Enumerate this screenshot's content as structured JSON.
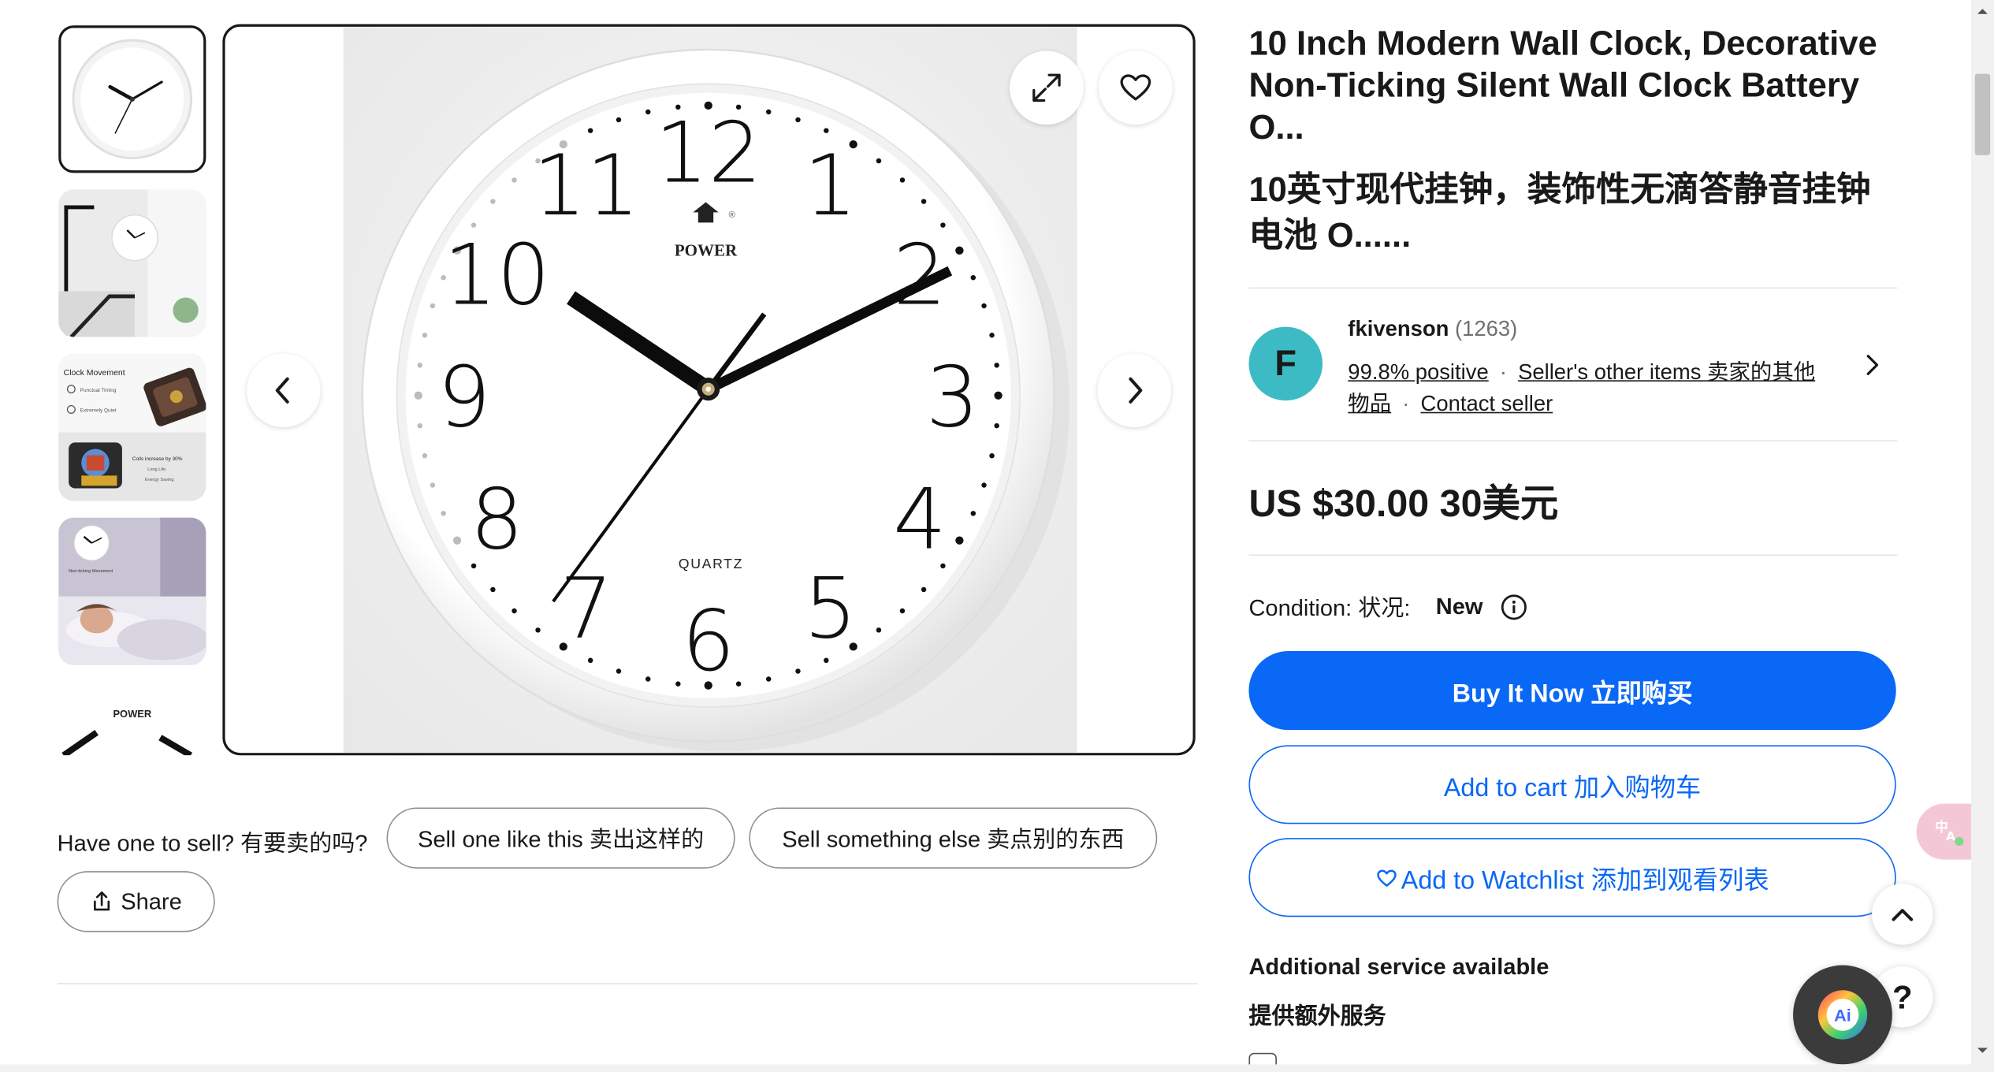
{
  "gallery": {
    "thumb_count": 5,
    "prev_button_label": "‹",
    "next_button_label": "›",
    "clock": {
      "brand": "POWER",
      "movement_label": "QUARTZ",
      "numerals": [
        "12",
        "1",
        "2",
        "3",
        "4",
        "5",
        "6",
        "7",
        "8",
        "9",
        "10",
        "11"
      ]
    },
    "thumbnails": [
      {
        "name": "clock-front"
      },
      {
        "name": "clock-on-wall"
      },
      {
        "name": "clock-movement",
        "texts": [
          "Clock Movement",
          "Punctual Timing",
          "Extremely Quiet",
          "Coils increase by 30%",
          "Long Life",
          "Energy Saving"
        ]
      },
      {
        "name": "bedroom-sleeping",
        "texts": [
          "Non-ticking Movement"
        ]
      },
      {
        "name": "clock-closeup"
      }
    ]
  },
  "sell_row": {
    "prompt": "Have one to sell? 有要卖的吗?",
    "sell_one_like_this": "Sell one like this 卖出这样的",
    "sell_something_else": "Sell something else 卖点别的东西",
    "share": "Share"
  },
  "listing": {
    "title": "10 Inch Modern Wall Clock, Decorative Non-Ticking Silent Wall Clock Battery O...",
    "title_translated": "10英寸现代挂钟，装饰性无滴答静音挂钟电池 O......"
  },
  "seller": {
    "avatar_letter": "F",
    "avatar_color": "#3dbbc5",
    "name": "fkivenson",
    "feedback_count": "(1263)",
    "positive": "99.8% positive",
    "other_items": "Seller's other items 卖家的其他",
    "other_items_cont": "物品",
    "contact": "Contact seller",
    "separator": "·"
  },
  "price": {
    "text": "US $30.00 30美元"
  },
  "condition": {
    "label": "Condition: 状况:",
    "value": "New"
  },
  "actions": {
    "buy_now": "Buy It Now 立即购买",
    "add_to_cart": "Add to cart 加入购物车",
    "add_to_watchlist": "Add to Watchlist 添加到观看列表"
  },
  "additional": {
    "heading": "Additional service available",
    "heading_translated": "提供额外服务"
  },
  "fabs": {
    "help": "?",
    "ai": "Ai"
  },
  "colors": {
    "accent_blue": "#0968f6",
    "text": "#191919",
    "avatar": "#3dbbc5"
  }
}
